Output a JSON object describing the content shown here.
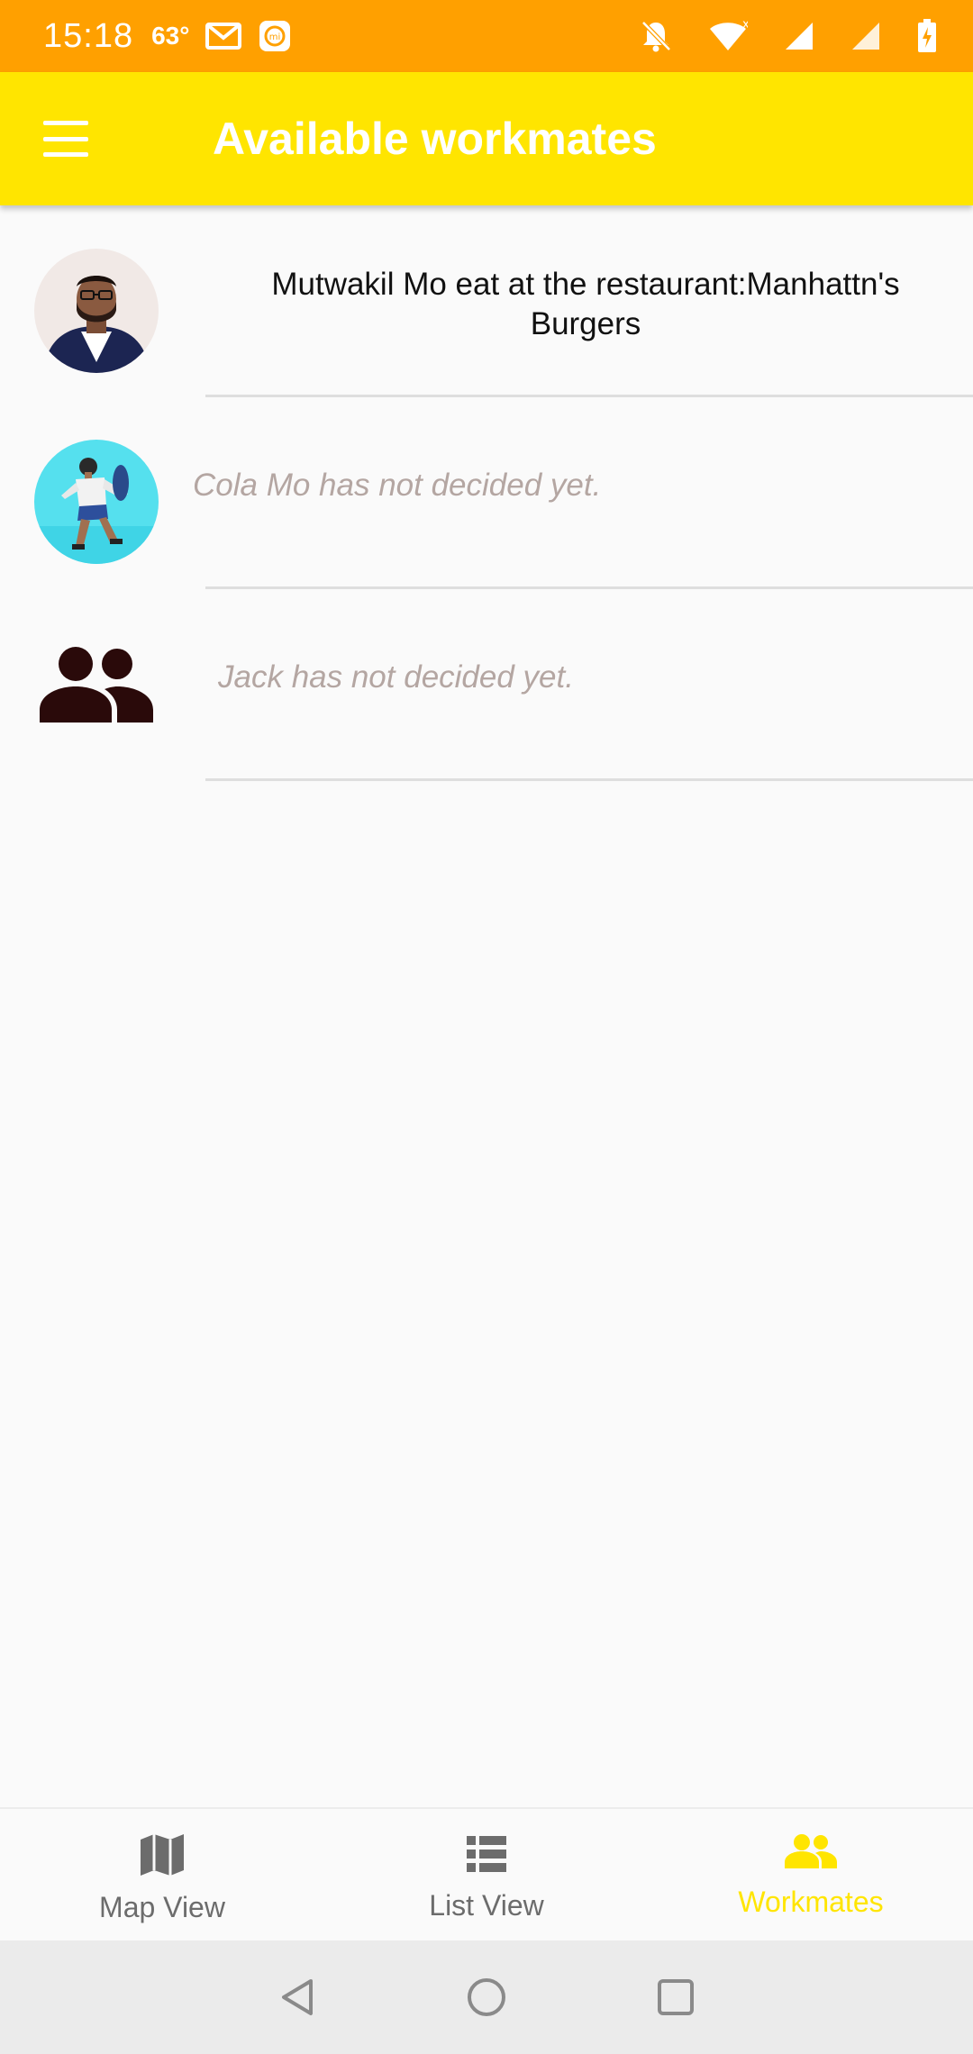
{
  "status": {
    "time": "15:18",
    "temp": "63°"
  },
  "appbar": {
    "title": "Available workmates",
    "menu_icon": "hamburger-menu-icon"
  },
  "workmates": [
    {
      "text": "Mutwakil Mo eat at the restaurant:Manhattn's Burgers",
      "decided": true,
      "avatar": "photo"
    },
    {
      "text": "Cola Mo has not decided yet.",
      "decided": false,
      "avatar": "photo"
    },
    {
      "text": "Jack has not decided yet.",
      "decided": false,
      "avatar": "people-icon"
    }
  ],
  "bottom_nav": [
    {
      "label": "Map View",
      "icon": "map-icon",
      "active": false
    },
    {
      "label": "List View",
      "icon": "list-icon",
      "active": false
    },
    {
      "label": "Workmates",
      "icon": "people-icon",
      "active": true
    }
  ],
  "colors": {
    "status_bar": "#ffa000",
    "app_bar": "#ffe500",
    "active_tab": "#ffe500",
    "undecided_text": "#b4a6a2"
  }
}
